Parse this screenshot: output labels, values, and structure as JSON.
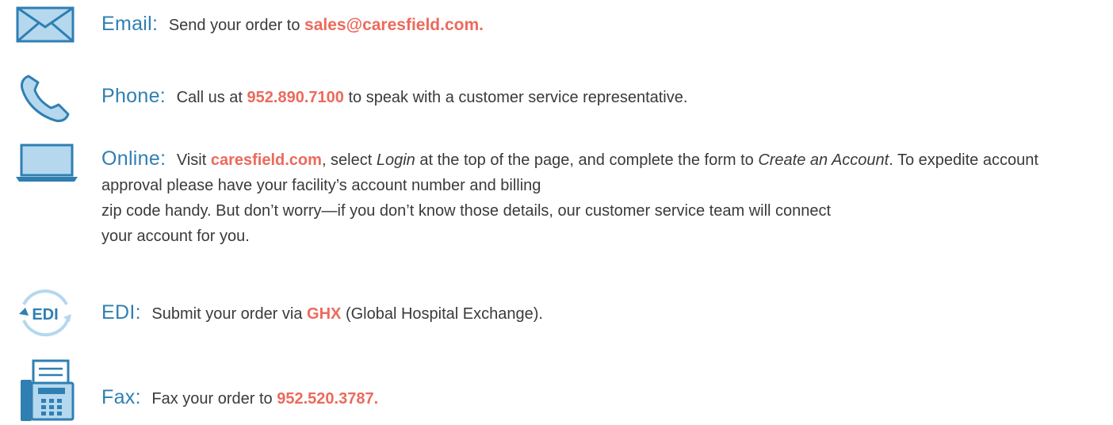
{
  "colors": {
    "icon_blue": "#2f7fb3",
    "icon_light": "#b5d8ee",
    "accent": "#ec6a5c",
    "text": "#3a3a3a"
  },
  "methods": [
    {
      "icon": "envelope-icon",
      "label": "Email:",
      "pre": "Send your order to",
      "highlight": "sales@caresfield.com."
    },
    {
      "icon": "phone-icon",
      "label": "Phone:",
      "pre": "Call us at",
      "highlight": "952.890.7100",
      "post": "to speak with a customer service representative."
    },
    {
      "icon": "laptop-icon",
      "label": "Online:",
      "pre": "Visit",
      "highlight": "caresfield.com",
      "post": ", select",
      "em1": "Login",
      "post2": "at the top of the page, and complete the form to",
      "em2": "Create an Account",
      "post3": ". To expedite account approval please have your facility’s account number and billing",
      "line2": "zip code handy. But don’t worry—if you don’t know those details, our customer service team will connect",
      "line3": "your account for you."
    },
    {
      "icon": "edi-icon",
      "icon_text": "EDI",
      "label": "EDI:",
      "pre": "Submit your order via",
      "highlight": "GHX",
      "post": "(Global Hospital Exchange)."
    },
    {
      "icon": "fax-icon",
      "label": "Fax:",
      "pre": "Fax your order to",
      "highlight": "952.520.3787."
    }
  ]
}
